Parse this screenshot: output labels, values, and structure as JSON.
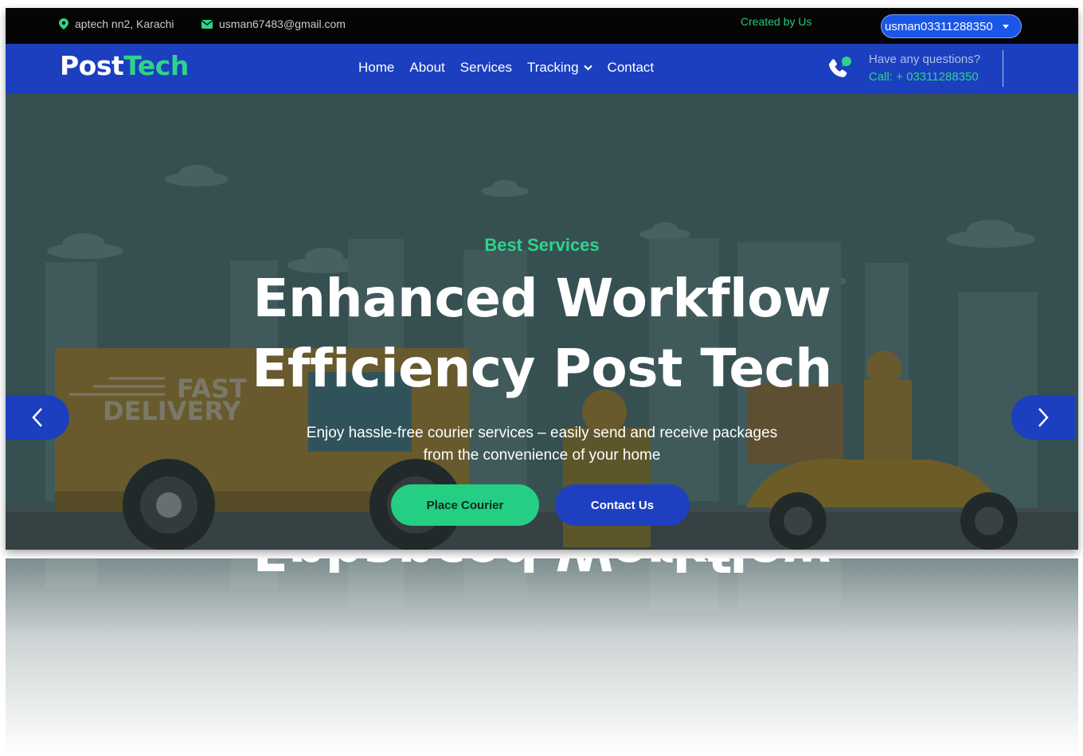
{
  "topbar": {
    "location": "aptech nn2, Karachi",
    "email": "usman67483@gmail.com",
    "created": "Created by Us",
    "user_button": "usman03311288350"
  },
  "navbar": {
    "logo_part1": "Post",
    "logo_part2": "Tech",
    "links": [
      "Home",
      "About",
      "Services",
      "Tracking",
      "Contact"
    ],
    "question": "Have any questions?",
    "call": "Call: + 03311288350"
  },
  "hero": {
    "subtitle": "Best Services",
    "headline_line1": "Enhanced Workflow",
    "headline_line2": "Efficiency Post Tech",
    "desc_line1": "Enjoy hassle-free courier services – easily send and receive packages",
    "desc_line2": "from the convenience of your home",
    "btn_place": "Place Courier",
    "btn_contact": "Contact Us",
    "truck_text1": "FAST",
    "truck_text2": "DELIVERY"
  },
  "colors": {
    "accent_green": "#2fd38a",
    "brand_blue": "#1b3fbf",
    "topbar_bg": "#050505"
  },
  "icons": [
    "map-marker-icon",
    "envelope-icon",
    "caret-down-icon",
    "phone-chat-icon",
    "chevron-left-icon",
    "chevron-right-icon"
  ]
}
